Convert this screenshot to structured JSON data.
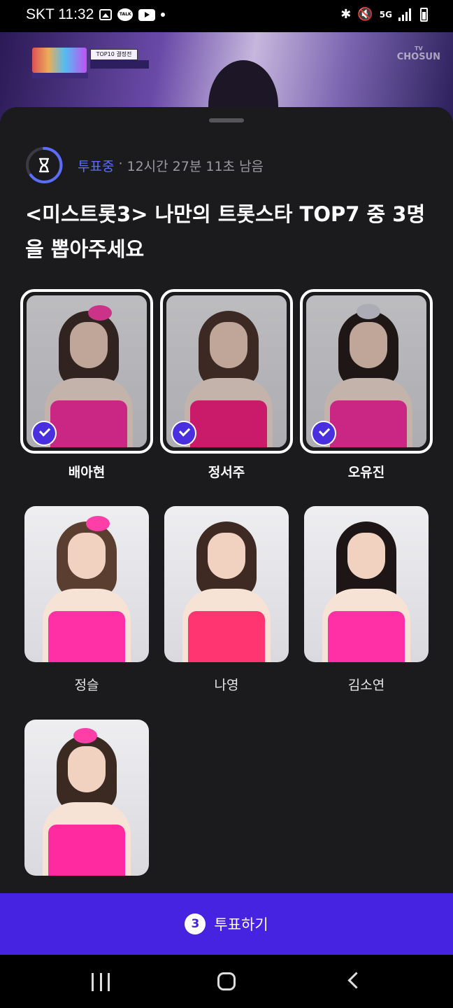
{
  "status_bar": {
    "carrier_time": "SKT 11:32",
    "icons": [
      "gallery-icon",
      "kakaotalk-icon",
      "youtube-icon",
      "dot-icon"
    ],
    "right_icons": [
      "bluetooth-icon",
      "mute-icon",
      "5g-icon",
      "signal-icon",
      "battery-icon"
    ],
    "talk": "TALK",
    "net": "5G"
  },
  "video": {
    "top10": "TOP10 결정전",
    "channel": "CHOSUN",
    "channel_top": "TV"
  },
  "vote": {
    "status": "투표중",
    "separator": "·",
    "remaining": "12시간 27분 11초 남음",
    "title": "<미스트롯3> 나만의 트롯스타 TOP7 중 3명을 뽑아주세요",
    "candidates": [
      {
        "name": "배아현",
        "selected": true
      },
      {
        "name": "정서주",
        "selected": true
      },
      {
        "name": "오유진",
        "selected": true
      },
      {
        "name": "정슬",
        "selected": false
      },
      {
        "name": "나영",
        "selected": false
      },
      {
        "name": "김소연",
        "selected": false
      },
      {
        "name": "",
        "selected": false
      }
    ],
    "button": {
      "count": "3",
      "label": "투표하기"
    }
  },
  "colors": {
    "accent": "#4523e0",
    "live": "#5b6cff",
    "sheet": "#1b1b1d"
  }
}
